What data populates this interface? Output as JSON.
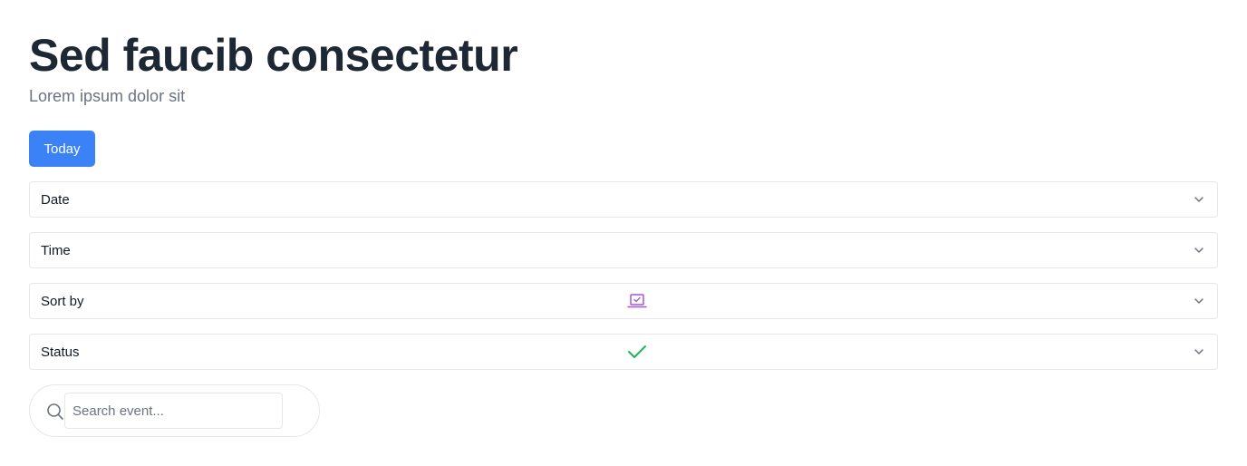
{
  "header": {
    "title": "Sed faucib consectetur",
    "subtitle": "Lorem ipsum dolor sit"
  },
  "toolbar": {
    "today_label": "Today"
  },
  "filters": [
    {
      "label": "Date",
      "icon": "chevron-down-icon"
    },
    {
      "label": "Time",
      "icon": "chevron-down-icon"
    },
    {
      "label": "Sort by",
      "status_icon": "laptop-check-icon",
      "icon": "chevron-down-icon"
    },
    {
      "label": "Status",
      "status_icon": "check-icon",
      "icon": "chevron-down-icon"
    }
  ],
  "search": {
    "placeholder": "Search event...",
    "value": ""
  },
  "colors": {
    "accent": "#3b82f6",
    "title": "#1e2734",
    "subtitle": "#6b7280",
    "laptop_icon": "#a855d8",
    "check_icon": "#22b45e"
  }
}
